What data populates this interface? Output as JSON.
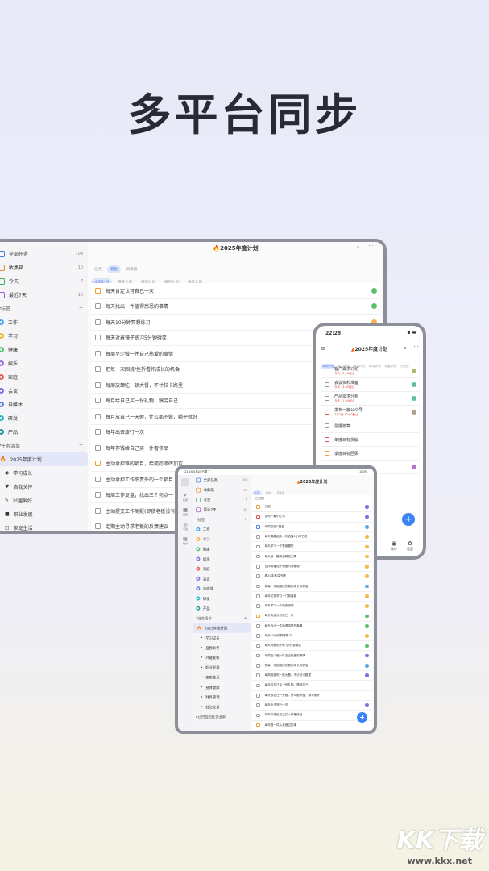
{
  "headline": "多平台同步",
  "tablet_large": {
    "title": "2025年度计划",
    "view_tabs": [
      "任务",
      "看板",
      "四象限"
    ],
    "sub_tabs": [
      "本周计划",
      "每天计划",
      "每周计划",
      "每月计划",
      "每年计划"
    ],
    "smart_lists": [
      {
        "label": "全部任务",
        "count": "104",
        "color": "#4a7bea"
      },
      {
        "label": "收集箱",
        "count": "10",
        "color": "#f08a24"
      },
      {
        "label": "今天",
        "count": "7",
        "color": "#3bb25a"
      },
      {
        "label": "最近7天",
        "count": "10",
        "color": "#9a5ad8"
      }
    ],
    "tags_header": "标签",
    "tags": [
      {
        "label": "工作",
        "color": "#4aa3f0"
      },
      {
        "label": "学习",
        "color": "#f2b632"
      },
      {
        "label": "健康",
        "color": "#4cc46a"
      },
      {
        "label": "娱乐",
        "color": "#9a6ae0"
      },
      {
        "label": "家庭",
        "color": "#ee5a5a"
      },
      {
        "label": "会议",
        "color": "#7a6ee6"
      },
      {
        "label": "自媒体",
        "color": "#5b7be0"
      },
      {
        "label": "研发",
        "color": "#27b8c8"
      },
      {
        "label": "产品",
        "color": "#1a9a9a"
      }
    ],
    "lists_header": "任务清单",
    "lists": [
      {
        "label": "2025年度计划",
        "icon": "🔥"
      },
      {
        "label": "学习成长",
        "icon": "◉"
      },
      {
        "label": "自我关怀",
        "icon": "♥"
      },
      {
        "label": "兴趣爱好",
        "icon": "✎"
      },
      {
        "label": "职业发展",
        "icon": "■"
      },
      {
        "label": "家庭生活",
        "icon": "□"
      }
    ],
    "tasks": [
      {
        "text": "每天肯定认可自己一次",
        "box": "#f0a030",
        "dot": "#5cc06a"
      },
      {
        "text": "每天找出一件值得感恩的事情",
        "box": "#999",
        "dot": "#5cc06a"
      },
      {
        "text": "每天10分钟冥想练习",
        "box": "#999",
        "dot": "#f5b04a"
      },
      {
        "text": "每天对着镜子练习5分钟微笑",
        "box": "#999",
        "dot": ""
      },
      {
        "text": "每周至少做一件自己热爱的事情",
        "box": "#999",
        "dot": ""
      },
      {
        "text": "把每一次困境/挫折看作成长的机会",
        "box": "#999",
        "dot": ""
      },
      {
        "text": "每周放肆吃一顿大餐，不计较卡路里",
        "box": "#999",
        "dot": ""
      },
      {
        "text": "每月给自己买一份礼物，犒劳自己",
        "box": "#999",
        "dot": ""
      },
      {
        "text": "每月放自己一天假，什么都不做，躺平就好",
        "box": "#999",
        "dot": ""
      },
      {
        "text": "每年出去旅行一次",
        "box": "#999",
        "dot": ""
      },
      {
        "text": "每年存钱给自己买一件奢侈品",
        "box": "#999",
        "dot": ""
      },
      {
        "text": "主动承担难的项目，给简历添砖加瓦",
        "box": "#f0a030",
        "dot": ""
      },
      {
        "text": "主动承担工作职责外的一个项目",
        "box": "#999",
        "dot": ""
      },
      {
        "text": "每周工作复盘，找出三个亮点一个改进点",
        "box": "#999",
        "dot": ""
      },
      {
        "text": "主动提交工作周报(即使老板没有要求)",
        "box": "#999",
        "dot": ""
      },
      {
        "text": "定期主动寻求老板的反馈建议",
        "box": "#999",
        "dot": ""
      }
    ]
  },
  "phone": {
    "time": "22:28",
    "title": "2025年度计划",
    "tabs": [
      "本周计划",
      "每天计划",
      "每周计划",
      "每月计划",
      "年度计划",
      "已完成"
    ],
    "tasks": [
      {
        "text": "客户需求讨论",
        "sub": "今天 12:00截止",
        "box": "#999",
        "dot": "#b5b56a"
      },
      {
        "text": "会议资料准备",
        "sub": "今天 14:00截止",
        "box": "#999",
        "dot": "#5cc0a0"
      },
      {
        "text": "产品需求分析",
        "sub": "今天 17:00截止",
        "box": "#999",
        "dot": "#5cc0a0"
      },
      {
        "text": "发布一篇公众号",
        "sub": "7月7日 12:00截止",
        "box": "#e05050",
        "dot": "#b0a090"
      },
      {
        "text": "票据核算",
        "sub": "",
        "box": "#999",
        "dot": ""
      },
      {
        "text": "年度目标拆解",
        "sub": "",
        "box": "#e05050",
        "dot": ""
      },
      {
        "text": "季度目标回顾",
        "sub": "",
        "box": "#f0a030",
        "dot": ""
      },
      {
        "text": "每月预算制定",
        "sub": "",
        "box": "#999",
        "dot": "#b070d0"
      }
    ],
    "nav": [
      "统计",
      "设置"
    ]
  },
  "tablet_small": {
    "status_left": "22:16 5月20日周二",
    "status_right": "100%",
    "title": "2025年度计划",
    "rail": [
      "任务",
      "日历",
      "专注",
      "统计"
    ],
    "view_tabs": [
      "任务",
      "看板",
      "四象限"
    ],
    "section": "已过期",
    "smart_lists": [
      {
        "label": "全部任务",
        "count": "104",
        "color": "#4a7bea"
      },
      {
        "label": "收集箱",
        "count": "10",
        "color": "#f08a24"
      },
      {
        "label": "今天",
        "count": "7",
        "color": "#3bb25a"
      },
      {
        "label": "最近7天",
        "count": "10",
        "color": "#9a5ad8"
      }
    ],
    "tags_header": "标签",
    "tags": [
      {
        "label": "工作",
        "color": "#4aa3f0"
      },
      {
        "label": "学习",
        "color": "#f2b632"
      },
      {
        "label": "健康",
        "color": "#4cc46a"
      },
      {
        "label": "娱乐",
        "color": "#9a6ae0"
      },
      {
        "label": "家庭",
        "color": "#ee5a5a"
      },
      {
        "label": "会议",
        "color": "#7a6ee6"
      },
      {
        "label": "自媒体",
        "color": "#5b7be0"
      },
      {
        "label": "研发",
        "color": "#27b8c8"
      },
      {
        "label": "产品",
        "color": "#1a9a9a"
      }
    ],
    "lists_header": "任务清单",
    "lists": [
      "2025年度计划",
      "学习成长",
      "自我关怀",
      "兴趣爱好",
      "职业发展",
      "家庭生活",
      "身体健康",
      "财务管理",
      "社交关系"
    ],
    "archived": "已归档的任务清单",
    "tasks": [
      {
        "text": "日报",
        "box": "#f0a030",
        "dot": "#8a6ae0"
      },
      {
        "text": "发布一篇小红书",
        "box": "#e05050",
        "dot": "#8a6ae0"
      },
      {
        "text": "每周总结&复盘",
        "box": "#4a7bea",
        "dot": "#5aa8e8"
      },
      {
        "text": "每天清晨起床，听选播1小时书籍",
        "box": "#999",
        "dot": "#f5b84a"
      },
      {
        "text": "每天学习一个思维模型",
        "box": "#999",
        "dot": "#f5b84a"
      },
      {
        "text": "每天读一篇英语精选文章",
        "box": "#999",
        "dot": "#f5b84a"
      },
      {
        "text": "坚持用番茄计划做时间管理",
        "box": "#999",
        "dot": "#f5b84a"
      },
      {
        "text": "看20本有益书籍",
        "box": "#999",
        "dot": "#f5b84a"
      },
      {
        "text": "把每一次困境挫折看作成长的机会",
        "box": "#999",
        "dot": "#5aa8e8"
      },
      {
        "text": "每年花钱学习一门新技能",
        "box": "#999",
        "dot": "#f5b84a"
      },
      {
        "text": "每年学习一个新的领域",
        "box": "#999",
        "dot": "#f5b84a"
      },
      {
        "text": "每天肯定认可自己一次",
        "box": "#f0a030",
        "dot": "#5cc06a"
      },
      {
        "text": "每天找出一件值得感恩的事情",
        "box": "#999",
        "dot": "#5cc06a"
      },
      {
        "text": "每天10分钟冥想练习",
        "box": "#999",
        "dot": "#f5b84a"
      },
      {
        "text": "每天对着镜子练习5分钟微笑",
        "box": "#999",
        "dot": "#5cc06a"
      },
      {
        "text": "每周至少做一件自己热爱的事情",
        "box": "#999",
        "dot": "#8a6ae0"
      },
      {
        "text": "把每一次困境挫折看作成长的机会",
        "box": "#999",
        "dot": "#5aa8e8"
      },
      {
        "text": "每周放肆吃一顿大餐，不计较卡路里",
        "box": "#999",
        "dot": "#8a6ae0"
      },
      {
        "text": "每月给自己买一份礼物，犒劳自己",
        "box": "#999",
        "dot": ""
      },
      {
        "text": "每月放自己一天假，什么都不做，躺平就好",
        "box": "#999",
        "dot": ""
      },
      {
        "text": "每年出去旅行一次",
        "box": "#999",
        "dot": "#8a6ae0"
      },
      {
        "text": "每年存钱给自己买一件奢侈品",
        "box": "#999",
        "dot": ""
      },
      {
        "text": "每年做一件从未做过的事",
        "box": "#f0a030",
        "dot": ""
      }
    ]
  },
  "watermark": {
    "brand": "KK下载",
    "url": "www.kkx.net"
  }
}
